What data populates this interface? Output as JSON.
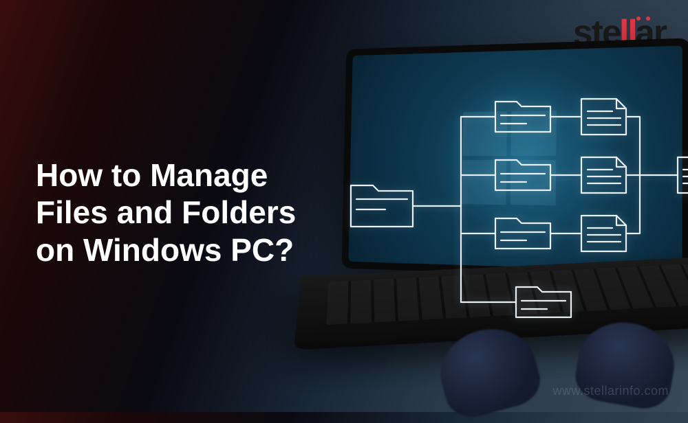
{
  "brand": {
    "name": "stellar"
  },
  "headline": {
    "line1": "How to Manage",
    "line2": "Files and Folders",
    "line3": "on Windows PC?"
  },
  "watermark": "www.stellarinfo.com",
  "diagram": {
    "root_icon": "folder-icon",
    "branches": [
      {
        "icon": "folder-icon",
        "child": "document-icon"
      },
      {
        "icon": "folder-icon",
        "child": "document-icon"
      },
      {
        "icon": "folder-icon",
        "child": "document-icon"
      },
      {
        "icon": "folder-icon",
        "child": null
      }
    ],
    "right_side": "document-icon"
  }
}
